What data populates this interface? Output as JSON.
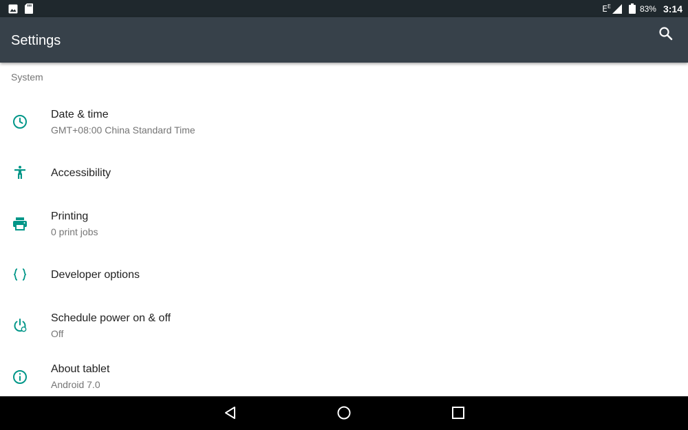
{
  "status_bar": {
    "network_label": "E",
    "network_sup": "E",
    "battery_percent": "83%",
    "time": "3:14",
    "icons": [
      "image-notification-icon",
      "sd-card-icon",
      "signal-icon",
      "battery-icon"
    ]
  },
  "app_bar": {
    "title": "Settings",
    "search_icon": "search-icon"
  },
  "section": {
    "header": "System"
  },
  "items": [
    {
      "title": "Date & time",
      "summary": "GMT+08:00 China Standard Time",
      "icon": "clock-icon"
    },
    {
      "title": "Accessibility",
      "summary": "",
      "icon": "accessibility-icon"
    },
    {
      "title": "Printing",
      "summary": "0 print jobs",
      "icon": "printer-icon"
    },
    {
      "title": "Developer options",
      "summary": "",
      "icon": "braces-icon"
    },
    {
      "title": "Schedule power on & off",
      "summary": "Off",
      "icon": "schedule-power-icon"
    },
    {
      "title": "About tablet",
      "summary": "Android 7.0",
      "icon": "info-icon"
    }
  ],
  "nav_bar": {
    "back": "back-icon",
    "home": "home-icon",
    "recents": "recents-icon"
  },
  "colors": {
    "accent": "#009688",
    "app_bar": "#37414a",
    "status_bar": "#1f282d",
    "nav_bar": "#000000",
    "title_text": "#212121",
    "secondary_text": "#757575"
  }
}
